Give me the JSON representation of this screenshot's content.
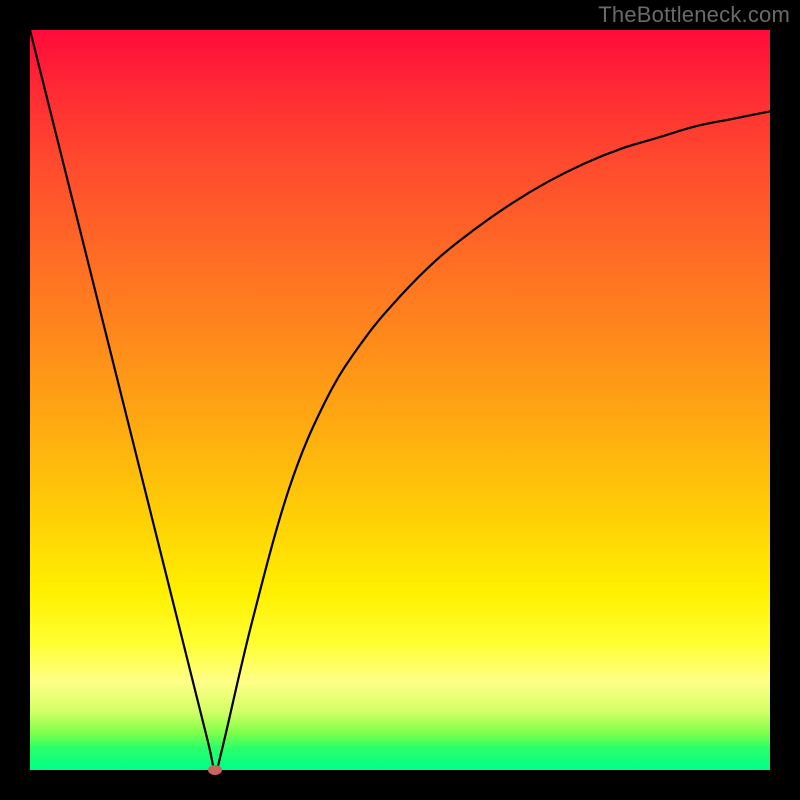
{
  "watermark": "TheBottleneck.com",
  "colors": {
    "frame": "#000000",
    "watermark_text": "#6a6a6a",
    "curve": "#000000",
    "marker_fill": "#c9655a",
    "gradient_top": "#ff0b3a",
    "gradient_bottom": "#00ff88"
  },
  "chart_data": {
    "type": "line",
    "title": "",
    "xlabel": "",
    "ylabel": "",
    "xlim": [
      0,
      100
    ],
    "ylim": [
      0,
      100
    ],
    "grid": false,
    "legend_position": "none",
    "series": [
      {
        "name": "bottleneck-curve",
        "x": [
          0,
          5,
          10,
          15,
          20,
          24,
          25,
          26,
          30,
          35,
          40,
          45,
          50,
          55,
          60,
          65,
          70,
          75,
          80,
          85,
          90,
          95,
          100
        ],
        "values": [
          100,
          80,
          60,
          40,
          20,
          4,
          0,
          3,
          20,
          38,
          50,
          58,
          64,
          69,
          73,
          76.5,
          79.5,
          82,
          84,
          85.5,
          87,
          88,
          89
        ]
      }
    ],
    "annotations": [
      {
        "name": "min-marker",
        "x": 25,
        "y": 0
      }
    ],
    "background_gradient": {
      "direction": "top-to-bottom",
      "stops": [
        {
          "pos": 0.0,
          "color": "#ff0b3a"
        },
        {
          "pos": 0.3,
          "color": "#ff6a25"
        },
        {
          "pos": 0.66,
          "color": "#ffd006"
        },
        {
          "pos": 0.83,
          "color": "#ffff33"
        },
        {
          "pos": 1.0,
          "color": "#00ff88"
        }
      ]
    }
  }
}
